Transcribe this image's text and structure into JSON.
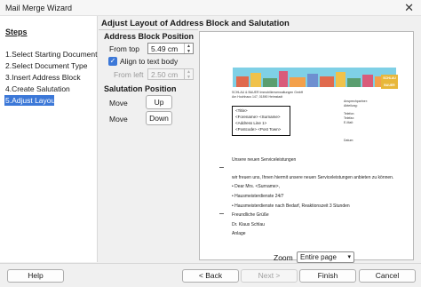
{
  "window": {
    "title": "Mail Merge Wizard",
    "close_glyph": "✕"
  },
  "steps": {
    "heading": "Steps",
    "items": [
      "1.Select Starting Document",
      "2.Select Document Type",
      "3.Insert Address Block",
      "4.Create Salutation",
      "5.Adjust Layout"
    ],
    "active_index": 4
  },
  "main": {
    "heading": "Adjust Layout of Address Block and Salutation",
    "address_section": {
      "title": "Address Block Position",
      "from_top_label": "From top",
      "from_top_value": "5.49 cm",
      "align_label": "Align to text body",
      "align_checked": true,
      "from_left_label": "From left",
      "from_left_value": "2.50 cm"
    },
    "salutation_section": {
      "title": "Salutation Position",
      "move_label_1": "Move",
      "up_button": "Up",
      "move_label_2": "Move",
      "down_button": "Down"
    }
  },
  "preview": {
    "sender_line_1": "SCHLAU & BAUER Immobilienverwaltungen GmbH",
    "sender_line_2": "Am Hochhaus 147, 01890 Heimstadt",
    "contact_label": "Ansprechpartner:",
    "dept_label": "Abteilung:",
    "phone_label": "Telefon:",
    "fax_label": "Telefax:",
    "email_label": "E-Mail:",
    "date_label": "Datum:",
    "logo_line_1": "SCHLAU",
    "logo_line_2": "BAUER",
    "address_fields": [
      "<Title>",
      "<Forename> <Surname>",
      "<Address Line 1>",
      "<Postcode> <Post Town>"
    ],
    "subject": "Unsere neuen Serviceleistungen",
    "intro": "wir freuen uns, Ihnen hiermit unsere neuen Serviceleistungen anbieten zu können.",
    "salutation": "Dear Mrs. <Surname>,",
    "bullets": [
      "Hausmeisterdienste 24/7",
      "Hausmeisterdienste nach Bedarf, Reaktionszeit 3 Stunden"
    ],
    "closing": "Freundliche Grüße",
    "signature": "Dr. Klaus Schlau",
    "attachment": "Anlage"
  },
  "zoom": {
    "label": "Zoom",
    "value": "Entire page"
  },
  "buttons": {
    "help": "Help",
    "back": "< Back",
    "next": "Next >",
    "finish": "Finish",
    "cancel": "Cancel"
  },
  "colors": {
    "accent": "#3c78d8",
    "banner_sky": "#7fd0e6",
    "logo": "#e8b73a"
  }
}
